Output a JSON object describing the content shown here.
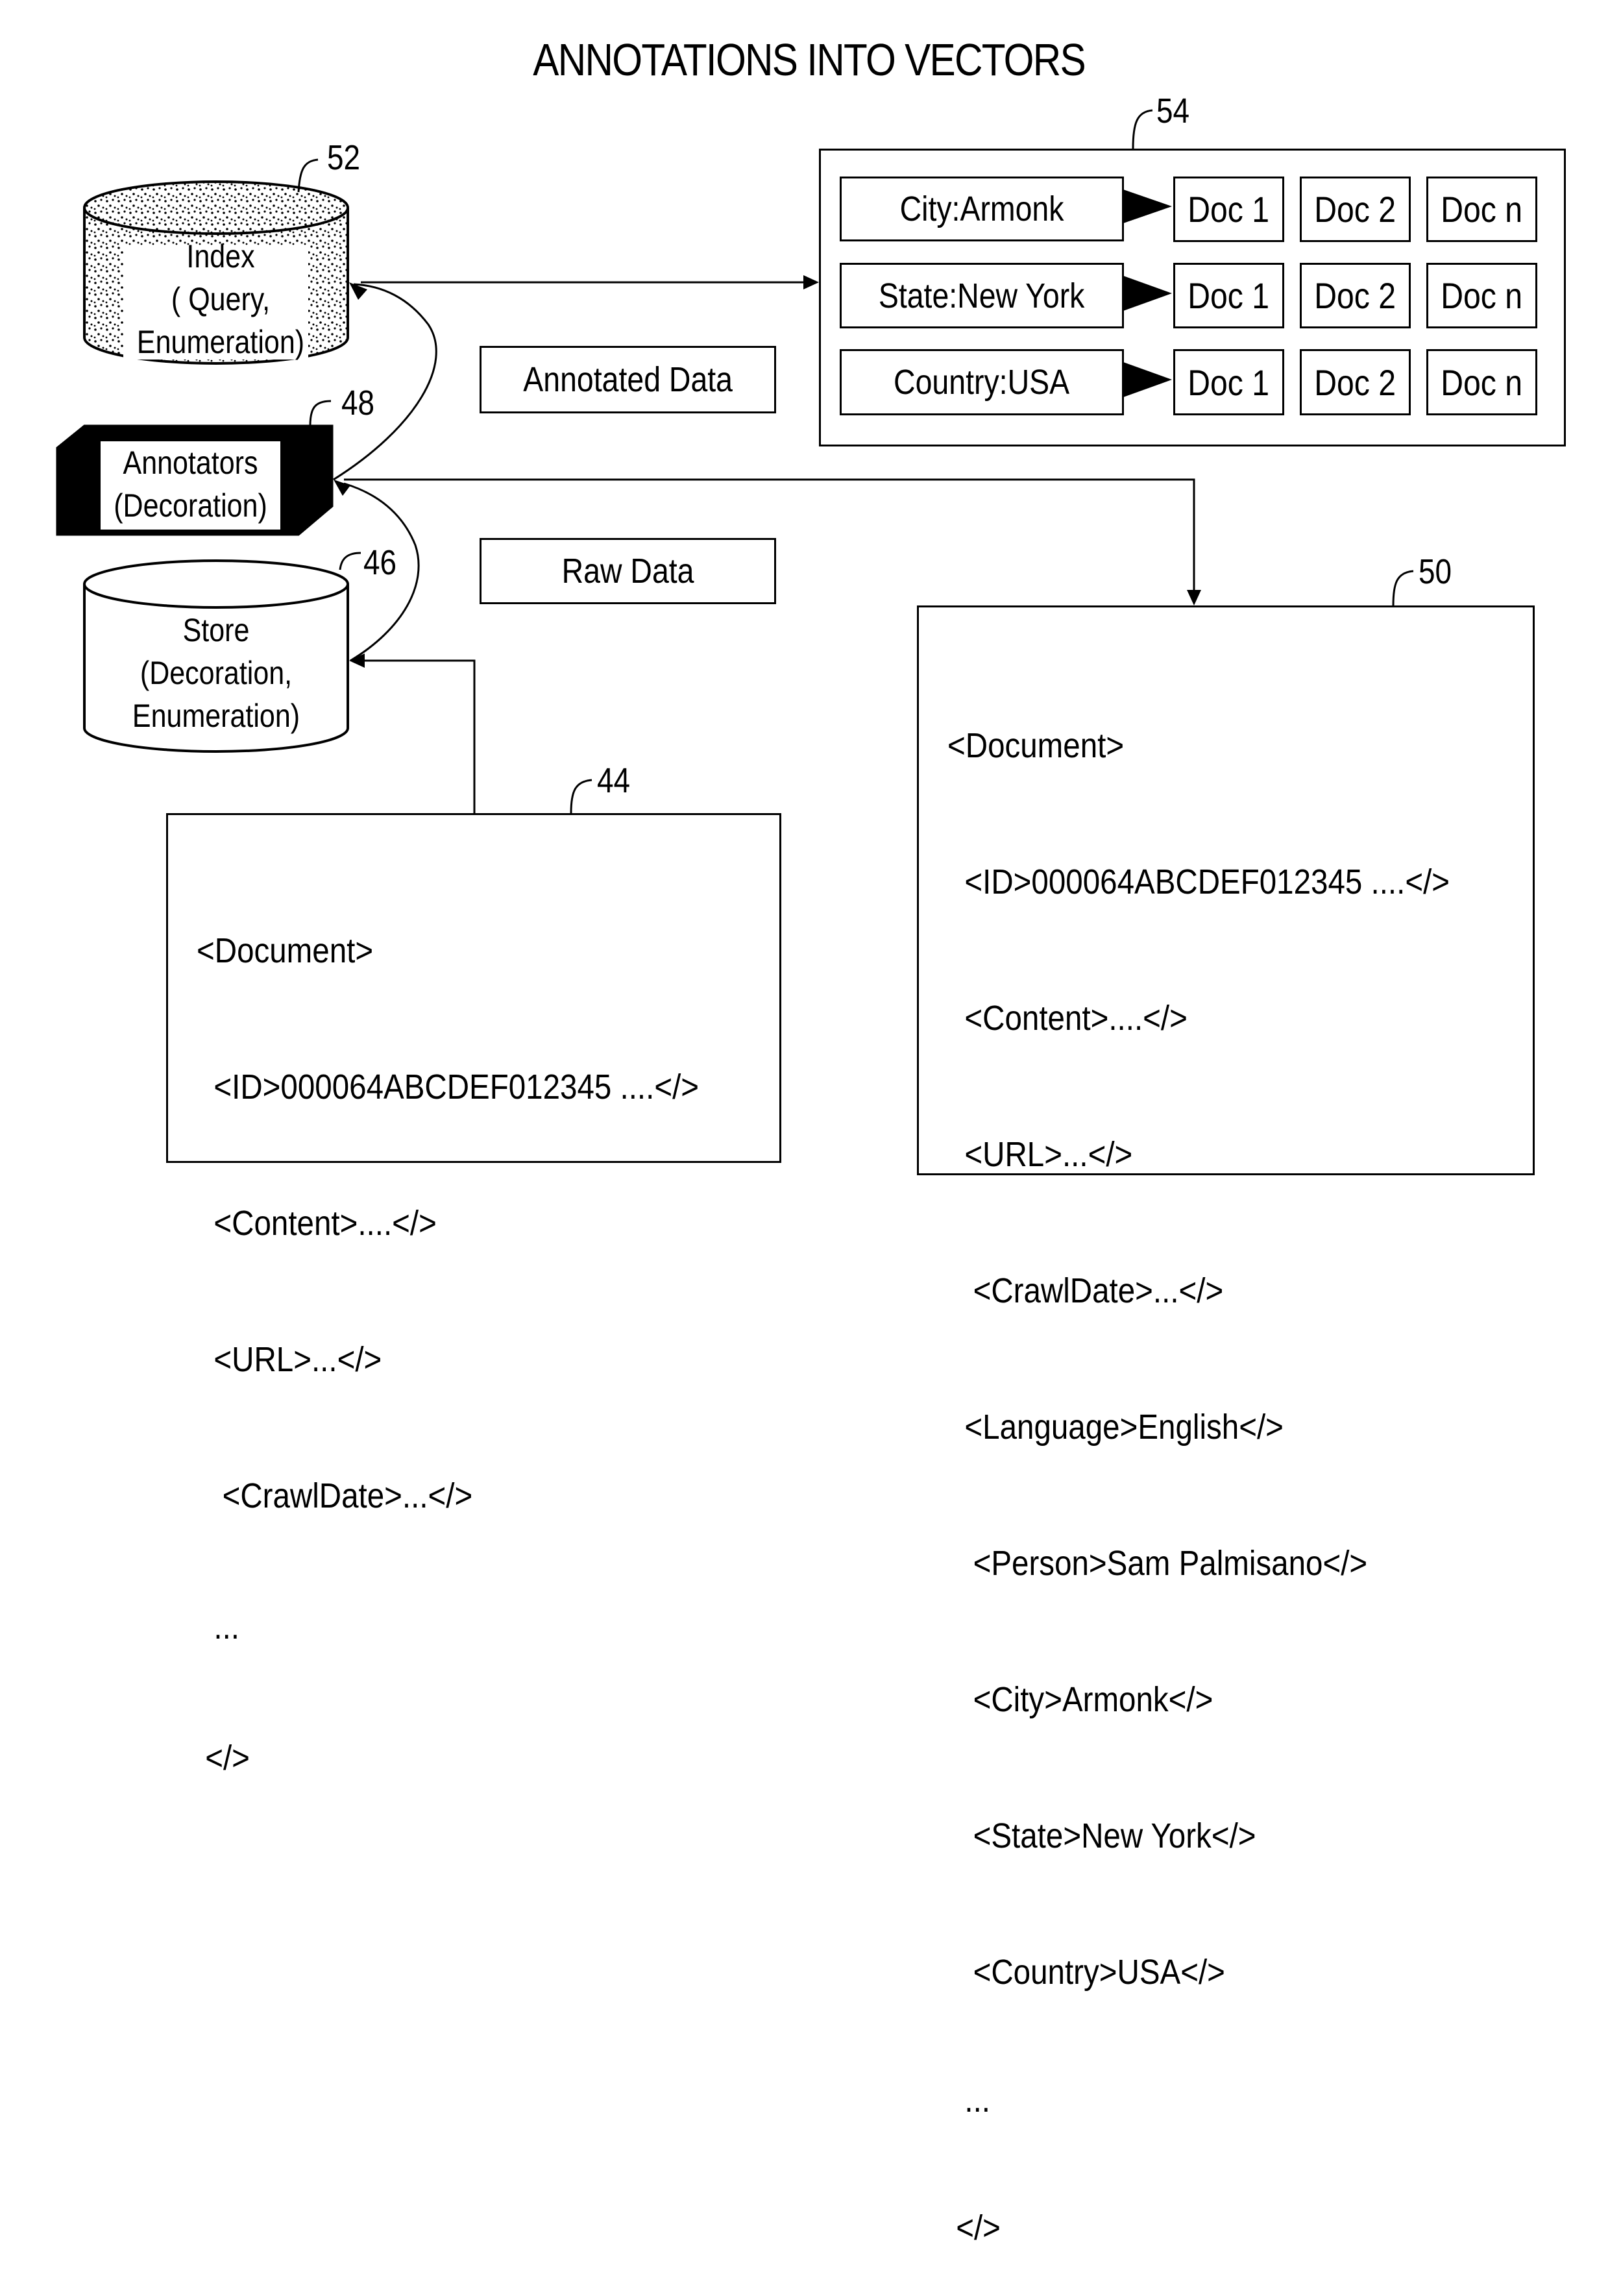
{
  "title": "ANNOTATIONS INTO VECTORS",
  "index_store": {
    "ref": "52",
    "lines": [
      "Index",
      "( Query,",
      "Enumeration)"
    ]
  },
  "annotators": {
    "ref": "48",
    "lines": [
      "Annotators",
      "(Decoration)"
    ]
  },
  "store": {
    "ref": "46",
    "lines": [
      "Store",
      "(Decoration,",
      "Enumeration)"
    ]
  },
  "labels": {
    "annotated_data": "Annotated Data",
    "raw_data": "Raw Data"
  },
  "vector_index": {
    "ref": "54",
    "rows": [
      {
        "key": "City:Armonk",
        "docs": [
          "Doc 1",
          "Doc 2",
          "Doc n"
        ]
      },
      {
        "key": "State:New York",
        "docs": [
          "Doc 1",
          "Doc 2",
          "Doc n"
        ]
      },
      {
        "key": "Country:USA",
        "docs": [
          "Doc 1",
          "Doc 2",
          "Doc n"
        ]
      }
    ]
  },
  "raw_document": {
    "ref": "44",
    "lines": [
      "<Document>",
      "  <ID>000064ABCDEF012345 ....</>",
      "  <Content>....</>",
      "  <URL>...</>",
      "   <CrawlDate>...</>",
      "  ...",
      " </>"
    ]
  },
  "annotated_document": {
    "ref": "50",
    "lines": [
      "<Document>",
      "  <ID>000064ABCDEF012345 ....</>",
      "  <Content>....</>",
      "  <URL>...</>",
      "   <CrawlDate>...</>",
      "  <Language>English</>",
      "   <Person>Sam Palmisano</>",
      "   <City>Armonk</>",
      "   <State>New York</>",
      "   <Country>USA</>",
      "  ...",
      " </>"
    ]
  }
}
